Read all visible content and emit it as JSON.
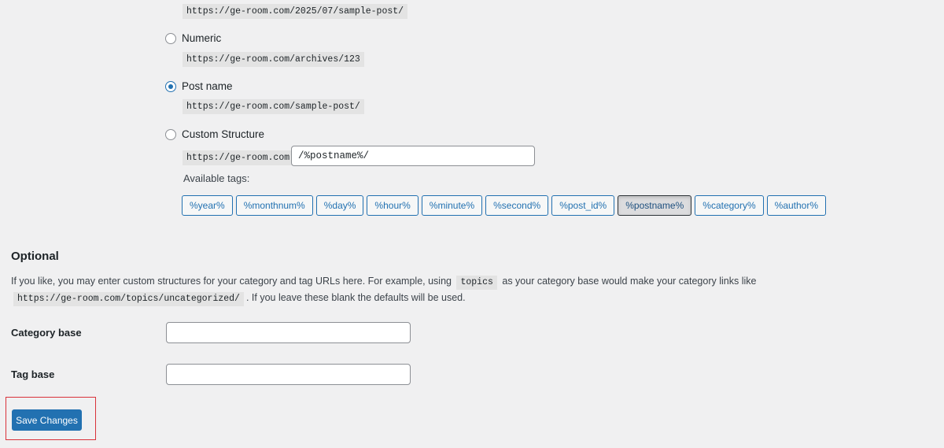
{
  "permalink_options": {
    "day_and_name_sample": "https://ge-room.com/2025/07/sample-post/",
    "numeric": {
      "label": "Numeric",
      "sample": "https://ge-room.com/archives/123",
      "checked": false
    },
    "post_name": {
      "label": "Post name",
      "sample": "https://ge-room.com/sample-post/",
      "checked": true
    },
    "custom": {
      "label": "Custom Structure",
      "prefix": "https://ge-room.com",
      "value": "/%postname%/",
      "checked": false
    }
  },
  "available_tags": {
    "label": "Available tags:",
    "tags": [
      "%year%",
      "%monthnum%",
      "%day%",
      "%hour%",
      "%minute%",
      "%second%",
      "%post_id%",
      "%postname%",
      "%category%",
      "%author%"
    ],
    "active": "%postname%"
  },
  "optional": {
    "title": "Optional",
    "desc_part1": "If you like, you may enter custom structures for your category and tag URLs here. For example, using",
    "desc_code1": "topics",
    "desc_part2": "as your category base would make your category links like",
    "desc_code2": "https://ge-room.com/topics/uncategorized/",
    "desc_part3": ". If you leave these blank the defaults will be used."
  },
  "fields": {
    "category_base": {
      "label": "Category base",
      "value": ""
    },
    "tag_base": {
      "label": "Tag base",
      "value": ""
    }
  },
  "actions": {
    "save_label": "Save Changes"
  },
  "colors": {
    "accent": "#2271b1",
    "highlight": "#d9323a",
    "background": "#f0f0f1"
  }
}
